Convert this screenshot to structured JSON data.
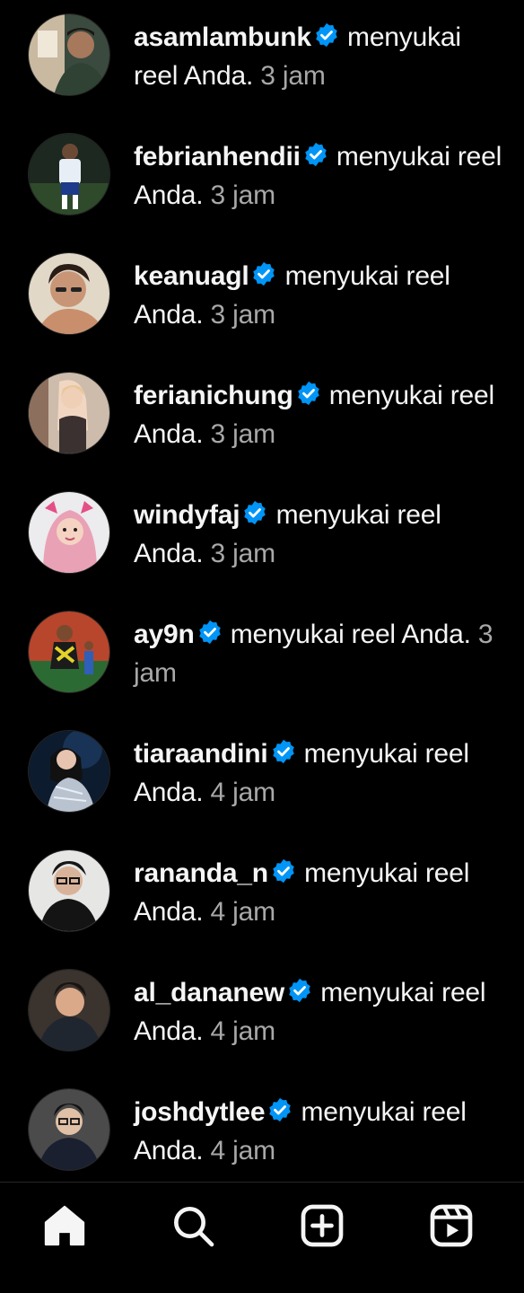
{
  "notifications": [
    {
      "username": "asamlambunk",
      "action": "menyukai reel Anda.",
      "time": "3 jam",
      "avatar_icon": "avatar-photo",
      "avatar_bg": "#2e3a33"
    },
    {
      "username": "febrianhendii",
      "action": "menyukai reel Anda.",
      "time": "3 jam",
      "avatar_icon": "avatar-photo",
      "avatar_bg": "#1f2a22"
    },
    {
      "username": "keanuagl",
      "action": "menyukai reel Anda.",
      "time": "3 jam",
      "avatar_icon": "avatar-photo",
      "avatar_bg": "#d9cfc0"
    },
    {
      "username": "ferianichung",
      "action": "menyukai reel Anda.",
      "time": "3 jam",
      "avatar_icon": "avatar-photo",
      "avatar_bg": "#cbb9a8"
    },
    {
      "username": "windyfaj",
      "action": "menyukai reel Anda.",
      "time": "3 jam",
      "avatar_icon": "avatar-photo",
      "avatar_bg": "#e9e6ea"
    },
    {
      "username": "ay9n",
      "action": "menyukai reel Anda.",
      "time": "3 jam",
      "avatar_icon": "avatar-photo",
      "avatar_bg": "#b5452c"
    },
    {
      "username": "tiaraandini",
      "action": "menyukai reel Anda.",
      "time": "4 jam",
      "avatar_icon": "avatar-photo",
      "avatar_bg": "#0f1f33"
    },
    {
      "username": "rananda_n",
      "action": "menyukai reel Anda.",
      "time": "4 jam",
      "avatar_icon": "avatar-photo",
      "avatar_bg": "#e4e4e2"
    },
    {
      "username": "al_dananew",
      "action": "menyukai reel Anda.",
      "time": "4 jam",
      "avatar_icon": "avatar-photo",
      "avatar_bg": "#3a3330"
    },
    {
      "username": "joshdytlee",
      "action": "menyukai reel Anda.",
      "time": "4 jam",
      "avatar_icon": "avatar-photo",
      "avatar_bg": "#4a4a4a"
    }
  ],
  "colors": {
    "background": "#000000",
    "text": "#f5f5f5",
    "muted": "#a8a8a8",
    "verified": "#0095f6",
    "divider": "#262626"
  },
  "bottom_nav": {
    "items": [
      {
        "icon": "home-icon",
        "active": true
      },
      {
        "icon": "search-icon",
        "active": false
      },
      {
        "icon": "create-icon",
        "active": false
      },
      {
        "icon": "reels-icon",
        "active": false
      }
    ]
  }
}
